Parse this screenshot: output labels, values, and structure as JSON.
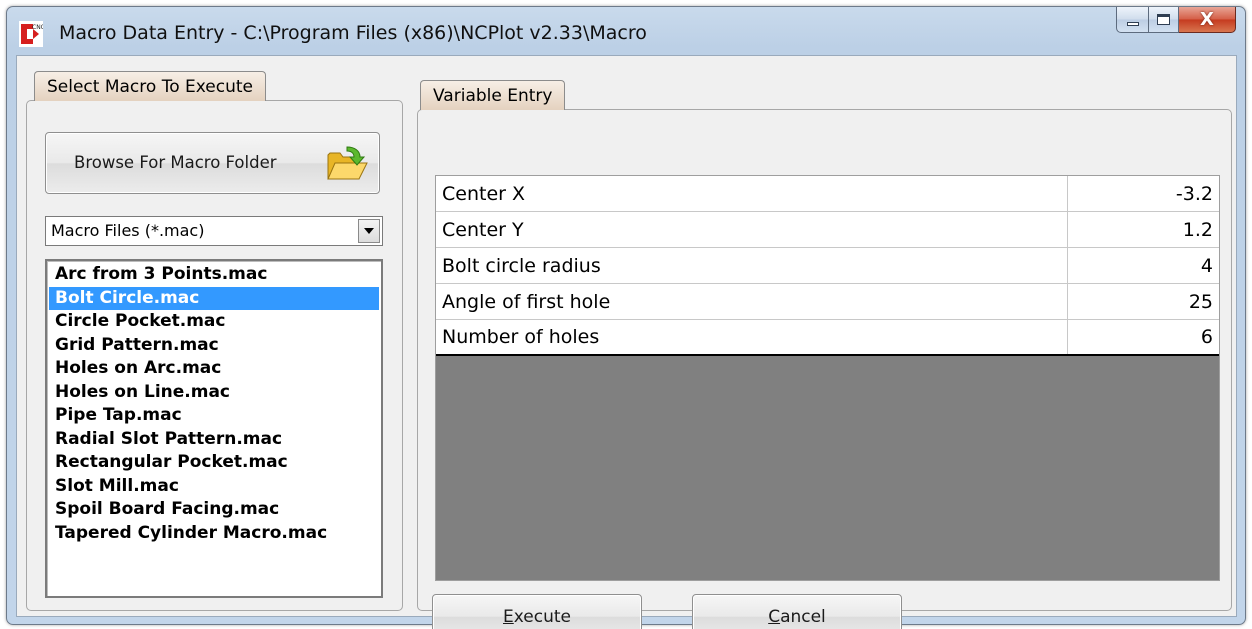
{
  "window": {
    "title": "Macro Data Entry - C:\\Program Files (x86)\\NCPlot v2.33\\Macro",
    "icon": "cnc-app-icon",
    "close_glyph": "X"
  },
  "left": {
    "tab_label": "Select Macro To Execute",
    "browse_label": "Browse For Macro Folder",
    "browse_icon": "folder-open-icon",
    "filter_value": "Macro Files (*.mac)",
    "macros": [
      "Arc from 3 Points.mac",
      "Bolt Circle.mac",
      "Circle Pocket.mac",
      "Grid Pattern.mac",
      "Holes on Arc.mac",
      "Holes on Line.mac",
      "Pipe Tap.mac",
      "Radial Slot Pattern.mac",
      "Rectangular Pocket.mac",
      "Slot Mill.mac",
      "Spoil Board Facing.mac",
      "Tapered Cylinder Macro.mac"
    ],
    "selected_index": 1
  },
  "right": {
    "tab_label": "Variable Entry",
    "variables": [
      {
        "name": "Center X",
        "value": "-3.2"
      },
      {
        "name": "Center Y",
        "value": "1.2"
      },
      {
        "name": "Bolt circle radius",
        "value": "4"
      },
      {
        "name": "Angle of first hole",
        "value": "25"
      },
      {
        "name": "Number of holes",
        "value": "6"
      }
    ],
    "execute_label": "Execute",
    "cancel_label": "Cancel"
  },
  "colors": {
    "selection": "#3399ff",
    "grid_empty": "#808080",
    "tab_fill": "#e4d2bf"
  }
}
